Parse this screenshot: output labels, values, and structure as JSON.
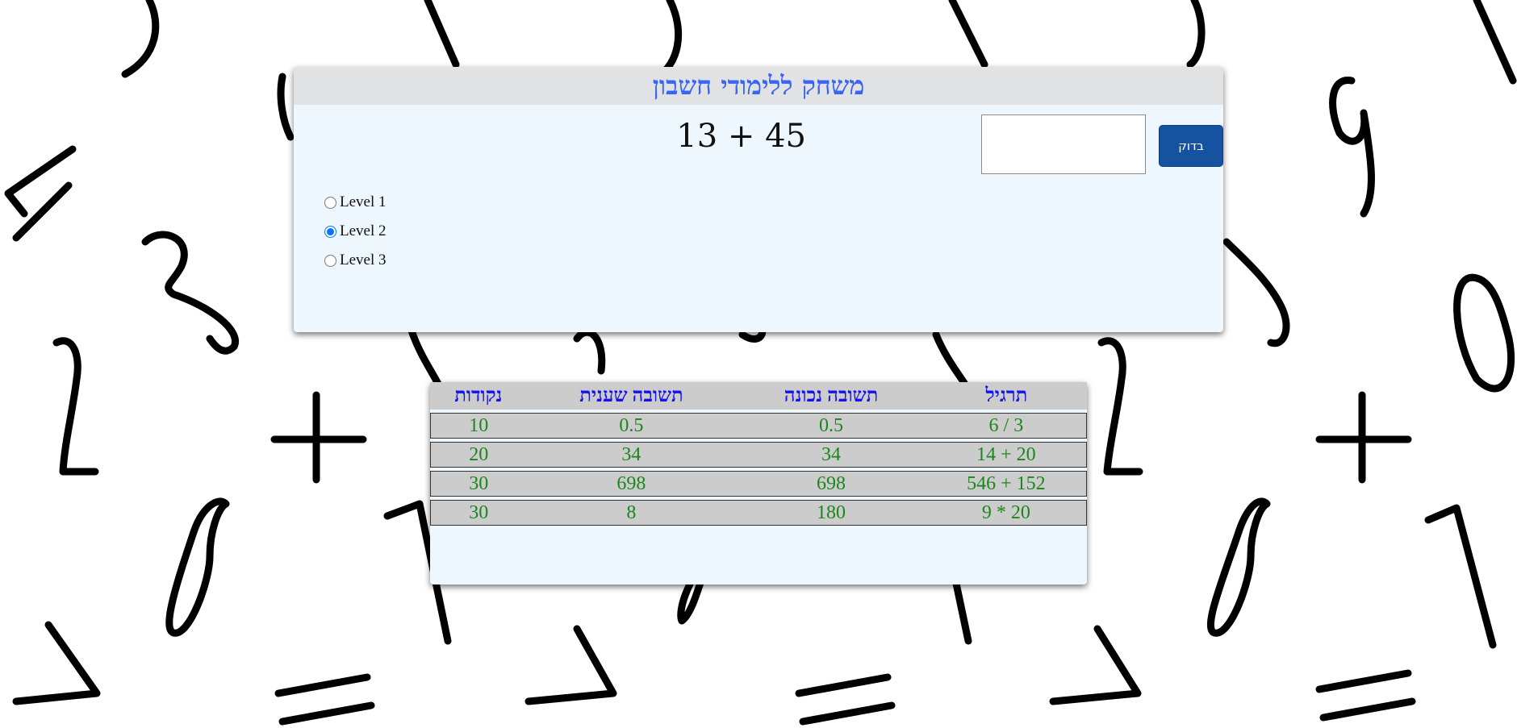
{
  "background": {
    "pattern_icon": "handwritten-math-symbols-pattern"
  },
  "game": {
    "title": "משחק ללימודי חשבון",
    "question": "13 + 45",
    "answer_value": "",
    "check_label": "בדוק",
    "levels": [
      {
        "label": "Level 1",
        "selected": false
      },
      {
        "label": "Level 2",
        "selected": true
      },
      {
        "label": "Level 3",
        "selected": false
      }
    ]
  },
  "score_table": {
    "headers": [
      "תרגיל",
      "תשובה נכונה",
      "תשובה שענית",
      "נקודות"
    ],
    "rows": [
      [
        "3 / 6",
        "0.5",
        "0.5",
        "10"
      ],
      [
        "20 + 14",
        "34",
        "34",
        "20"
      ],
      [
        "152 + 546",
        "698",
        "698",
        "30"
      ],
      [
        "20 * 9",
        "180",
        "8",
        "30"
      ]
    ]
  },
  "colors": {
    "title": "#3a64f4",
    "header_text": "#1414ea",
    "cell_text": "#1c861c",
    "button_bg": "#1552a0",
    "panel_bg": "#eef6fe"
  }
}
